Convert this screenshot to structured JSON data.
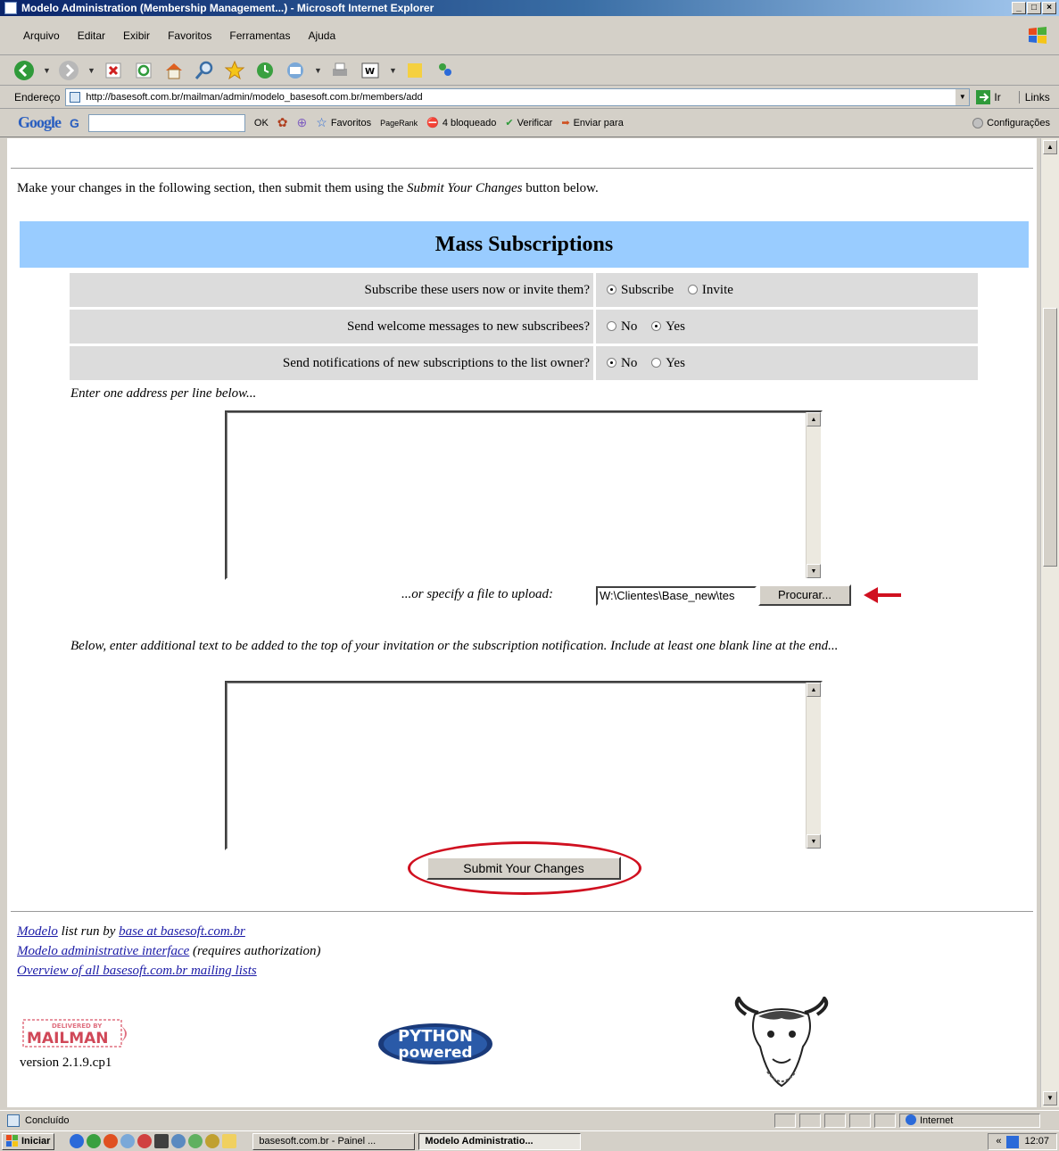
{
  "window": {
    "title": "Modelo Administration (Membership Management...) - Microsoft Internet Explorer",
    "controls": [
      "_",
      "□",
      "×"
    ]
  },
  "menu": [
    "Arquivo",
    "Editar",
    "Exibir",
    "Favoritos",
    "Ferramentas",
    "Ajuda"
  ],
  "address_bar": {
    "label": "Endereço",
    "url": "http://basesoft.com.br/mailman/admin/modelo_basesoft.com.br/members/add",
    "go_label": "Ir",
    "links_label": "Links"
  },
  "google_toolbar": {
    "logo": "Google",
    "g_label": "G",
    "ok_label": "OK",
    "favoritos_label": "Favoritos",
    "pagerank_label": "PageRank",
    "blocked_label": "4 bloqueado",
    "verificar_label": "Verificar",
    "enviar_label": "Enviar para",
    "config_label": "Configurações"
  },
  "page": {
    "instructions_pre": "Make your changes in the following section, then submit them using the ",
    "instructions_em": "Submit Your Changes",
    "instructions_post": " button below.",
    "section_title": "Mass Subscriptions",
    "options": [
      {
        "question": "Subscribe these users now or invite them?",
        "choices": [
          {
            "label": "Subscribe",
            "selected": true
          },
          {
            "label": "Invite",
            "selected": false
          }
        ]
      },
      {
        "question": "Send welcome messages to new subscribees?",
        "choices": [
          {
            "label": "No",
            "selected": false
          },
          {
            "label": "Yes",
            "selected": true
          }
        ]
      },
      {
        "question": "Send notifications of new subscriptions to the list owner?",
        "choices": [
          {
            "label": "No",
            "selected": true
          },
          {
            "label": "Yes",
            "selected": false
          }
        ]
      }
    ],
    "address_prompt": "Enter one address per line below...",
    "file_prompt": "...or specify a file to upload:",
    "file_value": "W:\\Clientes\\Base_new\\tes",
    "browse_label": "Procurar...",
    "additional_prompt": "Below, enter additional text to be added to the top of your invitation or the subscription notification. Include at least one blank line at the end...",
    "submit_label": "Submit Your Changes",
    "footer": {
      "list_link": "Modelo",
      "run_by": " list run by ",
      "owner_link": "base at basesoft.com.br",
      "admin_link": "Modelo administrative interface",
      "admin_note": " (requires authorization)",
      "overview_link": "Overview of all basesoft.com.br mailing lists"
    },
    "mailman_logo_text": "MAILMAN",
    "mailman_logo_top": "DELIVERED BY",
    "version": "version 2.1.9.cp1",
    "python_logo_text": [
      "PYTHON",
      "powered"
    ]
  },
  "status": {
    "text": "Concluído",
    "zone": "Internet"
  },
  "taskbar": {
    "start": "Iniciar",
    "tasks": [
      "basesoft.com.br - Painel ...",
      "Modelo Administratio..."
    ],
    "active_index": 1,
    "clock": "12:07"
  },
  "colors": {
    "section_header_bg": "#99ccff",
    "option_row_bg": "#dcdcdc",
    "annotation_red": "#d01020",
    "link": "#1a1aa6"
  }
}
